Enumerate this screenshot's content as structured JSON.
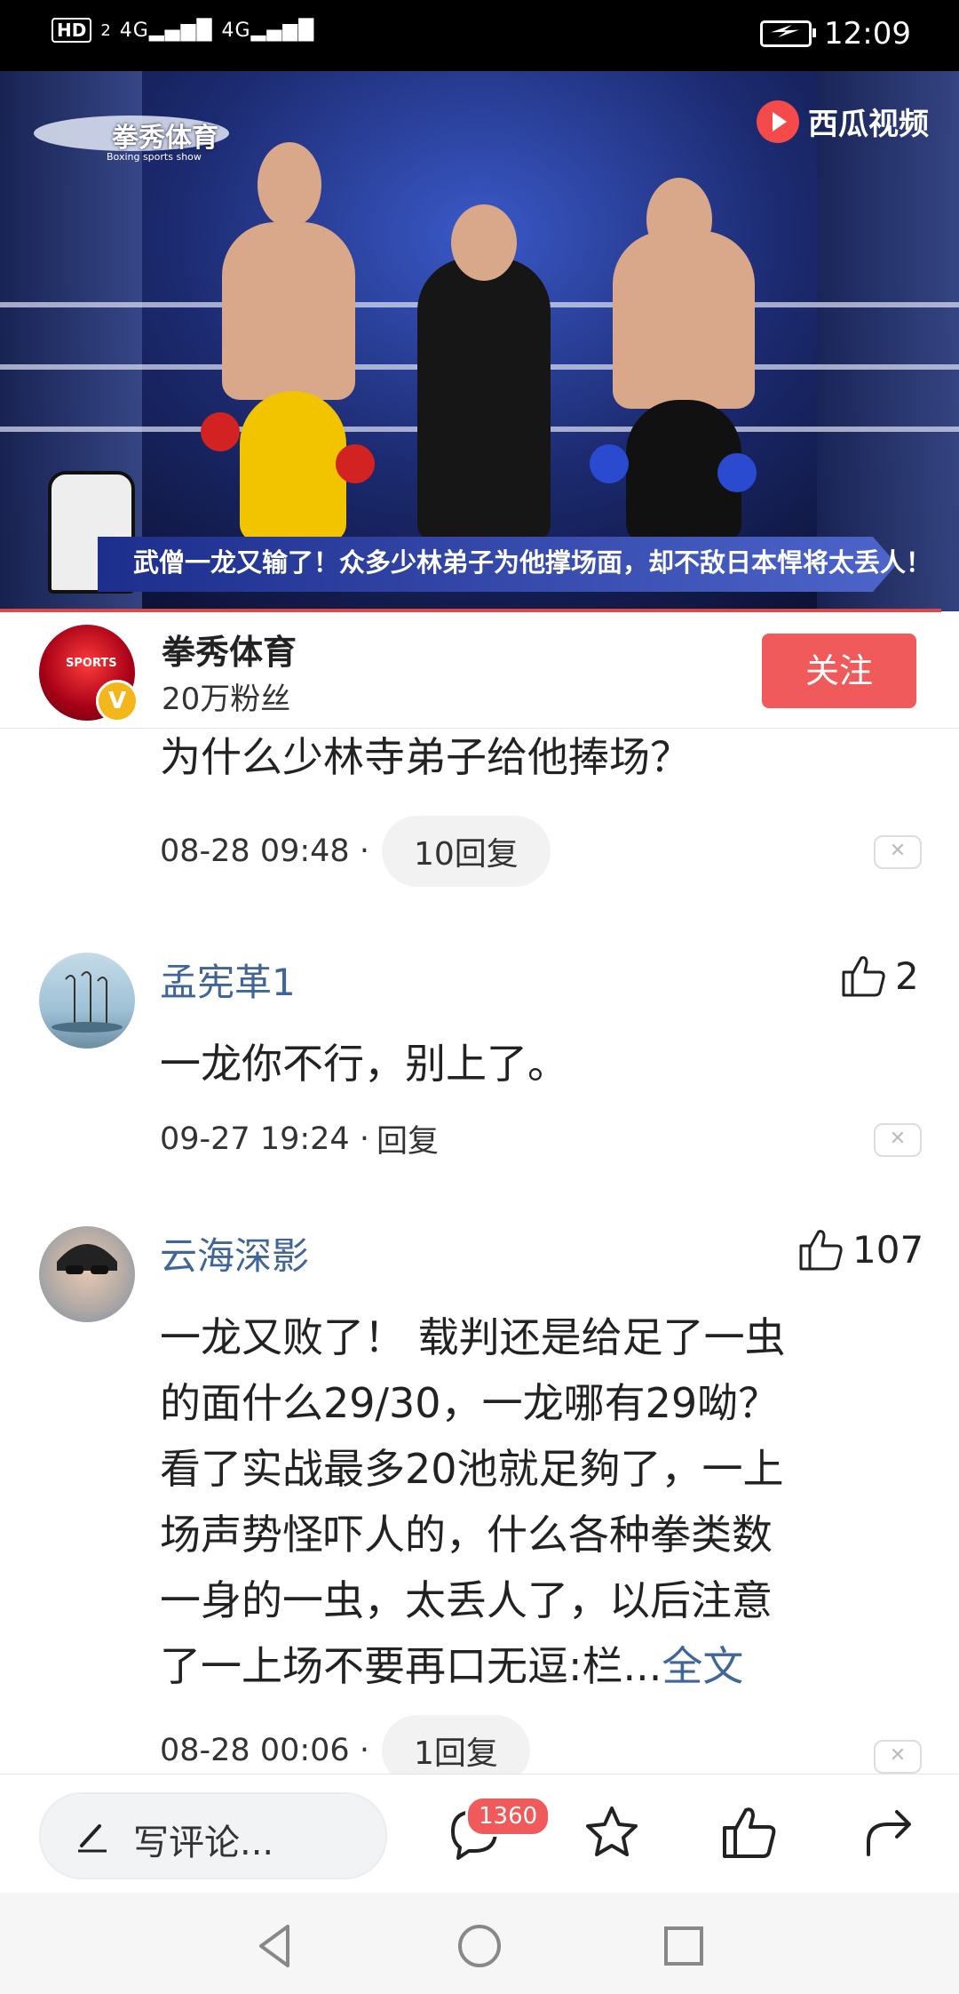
{
  "status_bar": {
    "hd": "HD",
    "sim": "2",
    "signal1": "4G",
    "signal2": "4G",
    "time": "12:09"
  },
  "video": {
    "logo_text": "拳秀体育",
    "logo_sub": "Boxing sports show",
    "brand": "西瓜视频",
    "caption": "武僧一龙又输了！众多少林弟子为他撑场面，却不敌日本悍将太丢人！"
  },
  "author": {
    "name": "拳秀体育",
    "fans": "20万粉丝",
    "avatar_text": "SPORTS",
    "verified": "V",
    "follow_label": "关注"
  },
  "comments": [
    {
      "text": "为什么少林寺弟子给他捧场？",
      "time": "08-28 09:48 ·",
      "reply_label": "10回复"
    },
    {
      "user": "孟宪革1",
      "likes": "2",
      "text": "一龙你不行，别上了。",
      "time": "09-27 19:24 ·",
      "reply_label": "回复"
    },
    {
      "user": "云海深影",
      "likes": "107",
      "lines": [
        "一龙又败了！ 载判还是给足了一虫",
        "的面什么29/30，一龙哪有29呦？",
        "看了实战最多20池就足夠了，一上",
        "场声势怪吓人的，什么各种拳类数",
        "一身的一虫，太丢人了，以后注意",
        "了一上场不要再口无逗:栏..."
      ],
      "more": "全文",
      "time": "08-28 00:06 ·",
      "reply_label": "1回复"
    }
  ],
  "bottom_bar": {
    "write_label": "写评论...",
    "comment_count": "1360"
  }
}
